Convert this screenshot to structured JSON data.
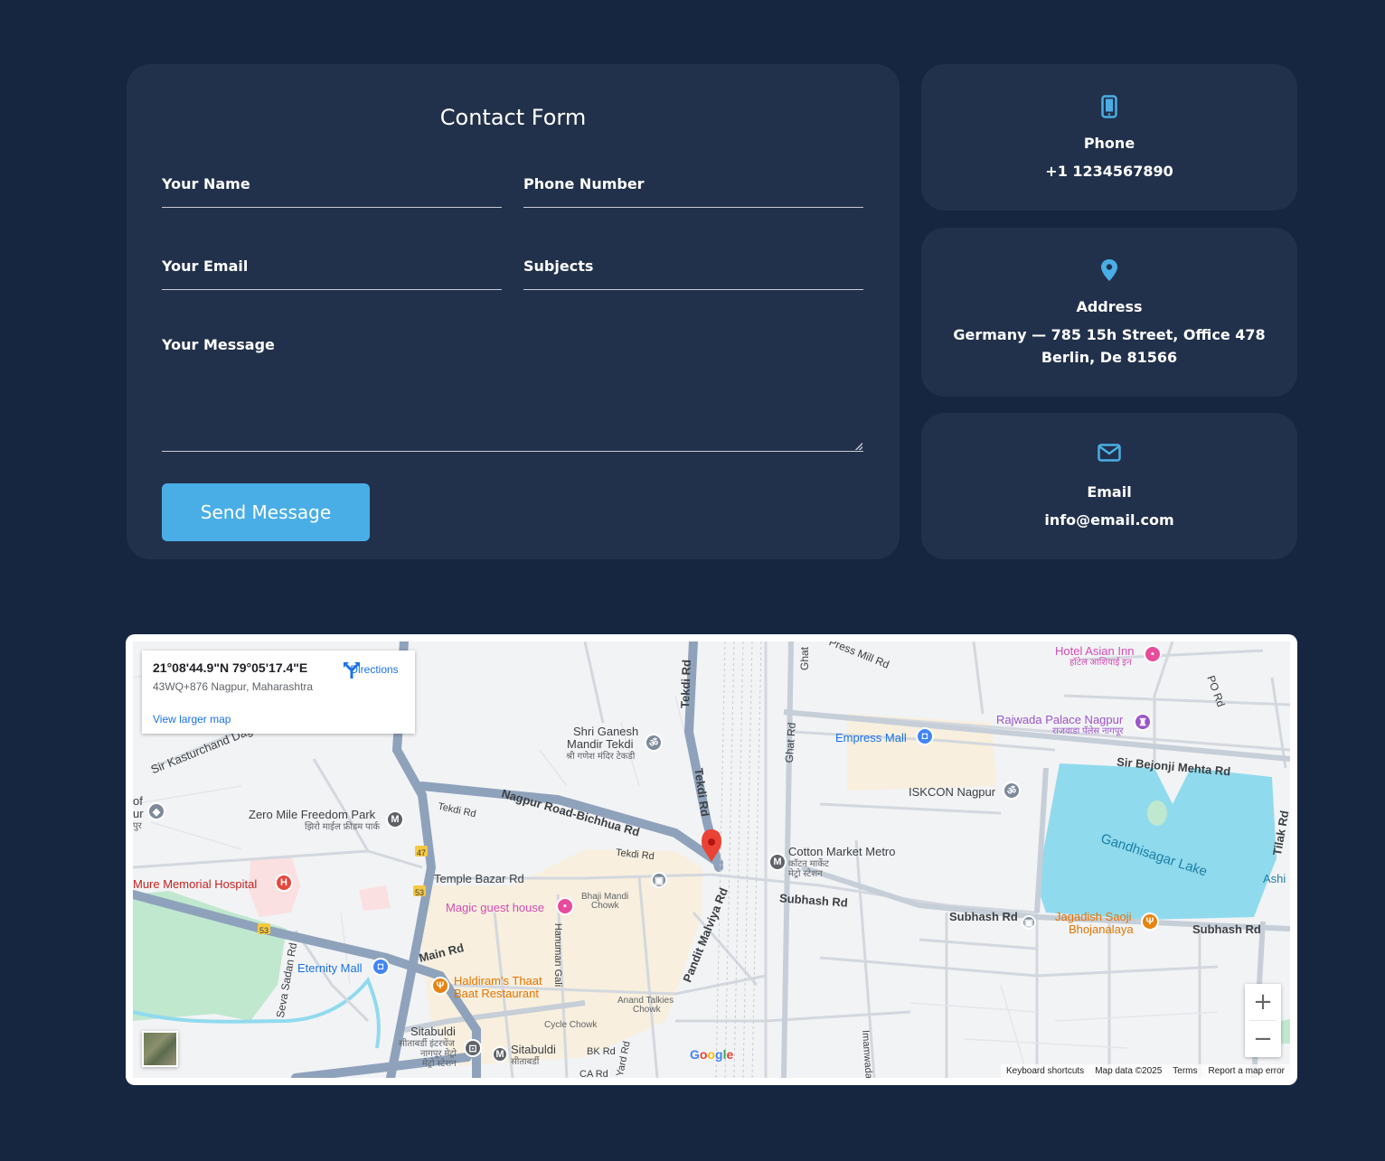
{
  "form": {
    "title": "Contact Form",
    "name_placeholder": "Your Name",
    "phone_placeholder": "Phone Number",
    "email_placeholder": "Your Email",
    "subject_placeholder": "Subjects",
    "message_placeholder": "Your Message",
    "send_label": "Send Message"
  },
  "contact": {
    "phone": {
      "label": "Phone",
      "value": "+1 1234567890",
      "icon": "mobile-phone-icon"
    },
    "address": {
      "label": "Address",
      "value": "Germany — 785 15h Street, Office 478 Berlin, De 81566",
      "icon": "map-pin-icon"
    },
    "email": {
      "label": "Email",
      "value": "info@email.com",
      "icon": "envelope-icon"
    }
  },
  "colors": {
    "background": "#172640",
    "card": "#22314b",
    "accent": "#4aaee6"
  },
  "map": {
    "coords": "21°08'44.9\"N 79°05'17.4\"E",
    "plus_code": "43WQ+876 Nagpur, Maharashtra",
    "directions": "Directions",
    "larger_map": "View larger map",
    "zoom_in": "+",
    "zoom_out": "−",
    "google": "Google",
    "attribution": {
      "shortcuts": "Keyboard shortcuts",
      "data": "Map data ©2025",
      "terms": "Terms",
      "report": "Report a map error"
    },
    "labels": {
      "hotel_asian": "Hotel Asian Inn",
      "hotel_asian_hi": "हॉटेल आशियाई इन",
      "press_mill": "Press Mill Rd",
      "ghat_rd_top": "Ghat",
      "po_rd": "PO Rd",
      "rajwada": "Rajwada Palace Nagpur",
      "rajwada_hi": "राजवाडा पॅलेस नागपूर",
      "empress_mall": "Empress Mall",
      "sir_bejonji": "Sir Bejonji Mehta Rd",
      "shri_ganesh": "Shri Ganesh",
      "mandir_tekdi": "Mandir Tekdi",
      "ganesh_hi": "श्री गणेश मंदिर टेकडी",
      "tekdi_rd": "Tekdi Rd",
      "ghat_rd": "Ghat Rd",
      "sir_kasturchand": "Sir Kasturchand Daga",
      "iskcon": "ISKCON Nagpur",
      "zero_mile": "Zero Mile Freedom Park",
      "zero_mile_hi": "झिरो माईल फ्रीडम पार्क",
      "nagpur_road": "Nagpur Road-Bichhua Rd",
      "tekdi_rd2": "Tekdi Rd",
      "tekdi_rd3": "Tekdi Rd",
      "cotton_market": "Cotton Market Metro",
      "cotton_market_hi": "कॉटन मार्केट",
      "cotton_market_hi2": "मेट्रो स्टेशन",
      "gandhisagar": "Gandhisagar Lake",
      "tilak_rd": "Tilak Rd",
      "mure_hospital": "Mure Memorial Hospital",
      "temple_bazar": "Temple Bazar Rd",
      "bhaji_mandi": "Bhaji Mandi",
      "bhaji_chowk": "Chowk",
      "subhash_rd1": "Subhash Rd",
      "subhash_rd2": "Subhash Rd",
      "subhash_rd3": "Subhash Rd",
      "ashi": "Ashi",
      "magic_guest": "Magic guest house",
      "jagadish": "Jagadish Saoji",
      "bhojanalaya": "Bhojanalaya",
      "pandit_malviya": "Pandit Malviya Rd",
      "main_rd": "Main Rd",
      "eternity_mall": "Eternity Mall",
      "seva_sadan": "Seva Sadan Rd",
      "hanuman_gali": "Hanuman Gali",
      "haldirams": "Haldiram's Thaat",
      "baat_restaurant": "Baat Restaurant",
      "anand_talkies": "Anand Talkies",
      "anand_chowk": "Chowk",
      "cycle_chowk": "Cycle Chowk",
      "sitabuldi1": "Sitabuldi",
      "sitabuldi_hi1": "सीताबर्डी इंटरचेंज",
      "sitabuldi_hi2": "नागपूर मेट्रो",
      "sitabuldi_hi3": "मेट्रो स्टेशन",
      "sitabuldi2": "Sitabuldi",
      "sitabuldi2_hi": "सीताबर्डी",
      "bk_rd": "BK Rd",
      "yard_rd": "Yard Rd",
      "ca_rd": "CA Rd",
      "imamwada": "Imamwada",
      "route_47": "47",
      "route_53a": "53",
      "route_53b": "53",
      "of_label": "of",
      "ur_label": "ur",
      "pur_label": "पुर"
    }
  }
}
